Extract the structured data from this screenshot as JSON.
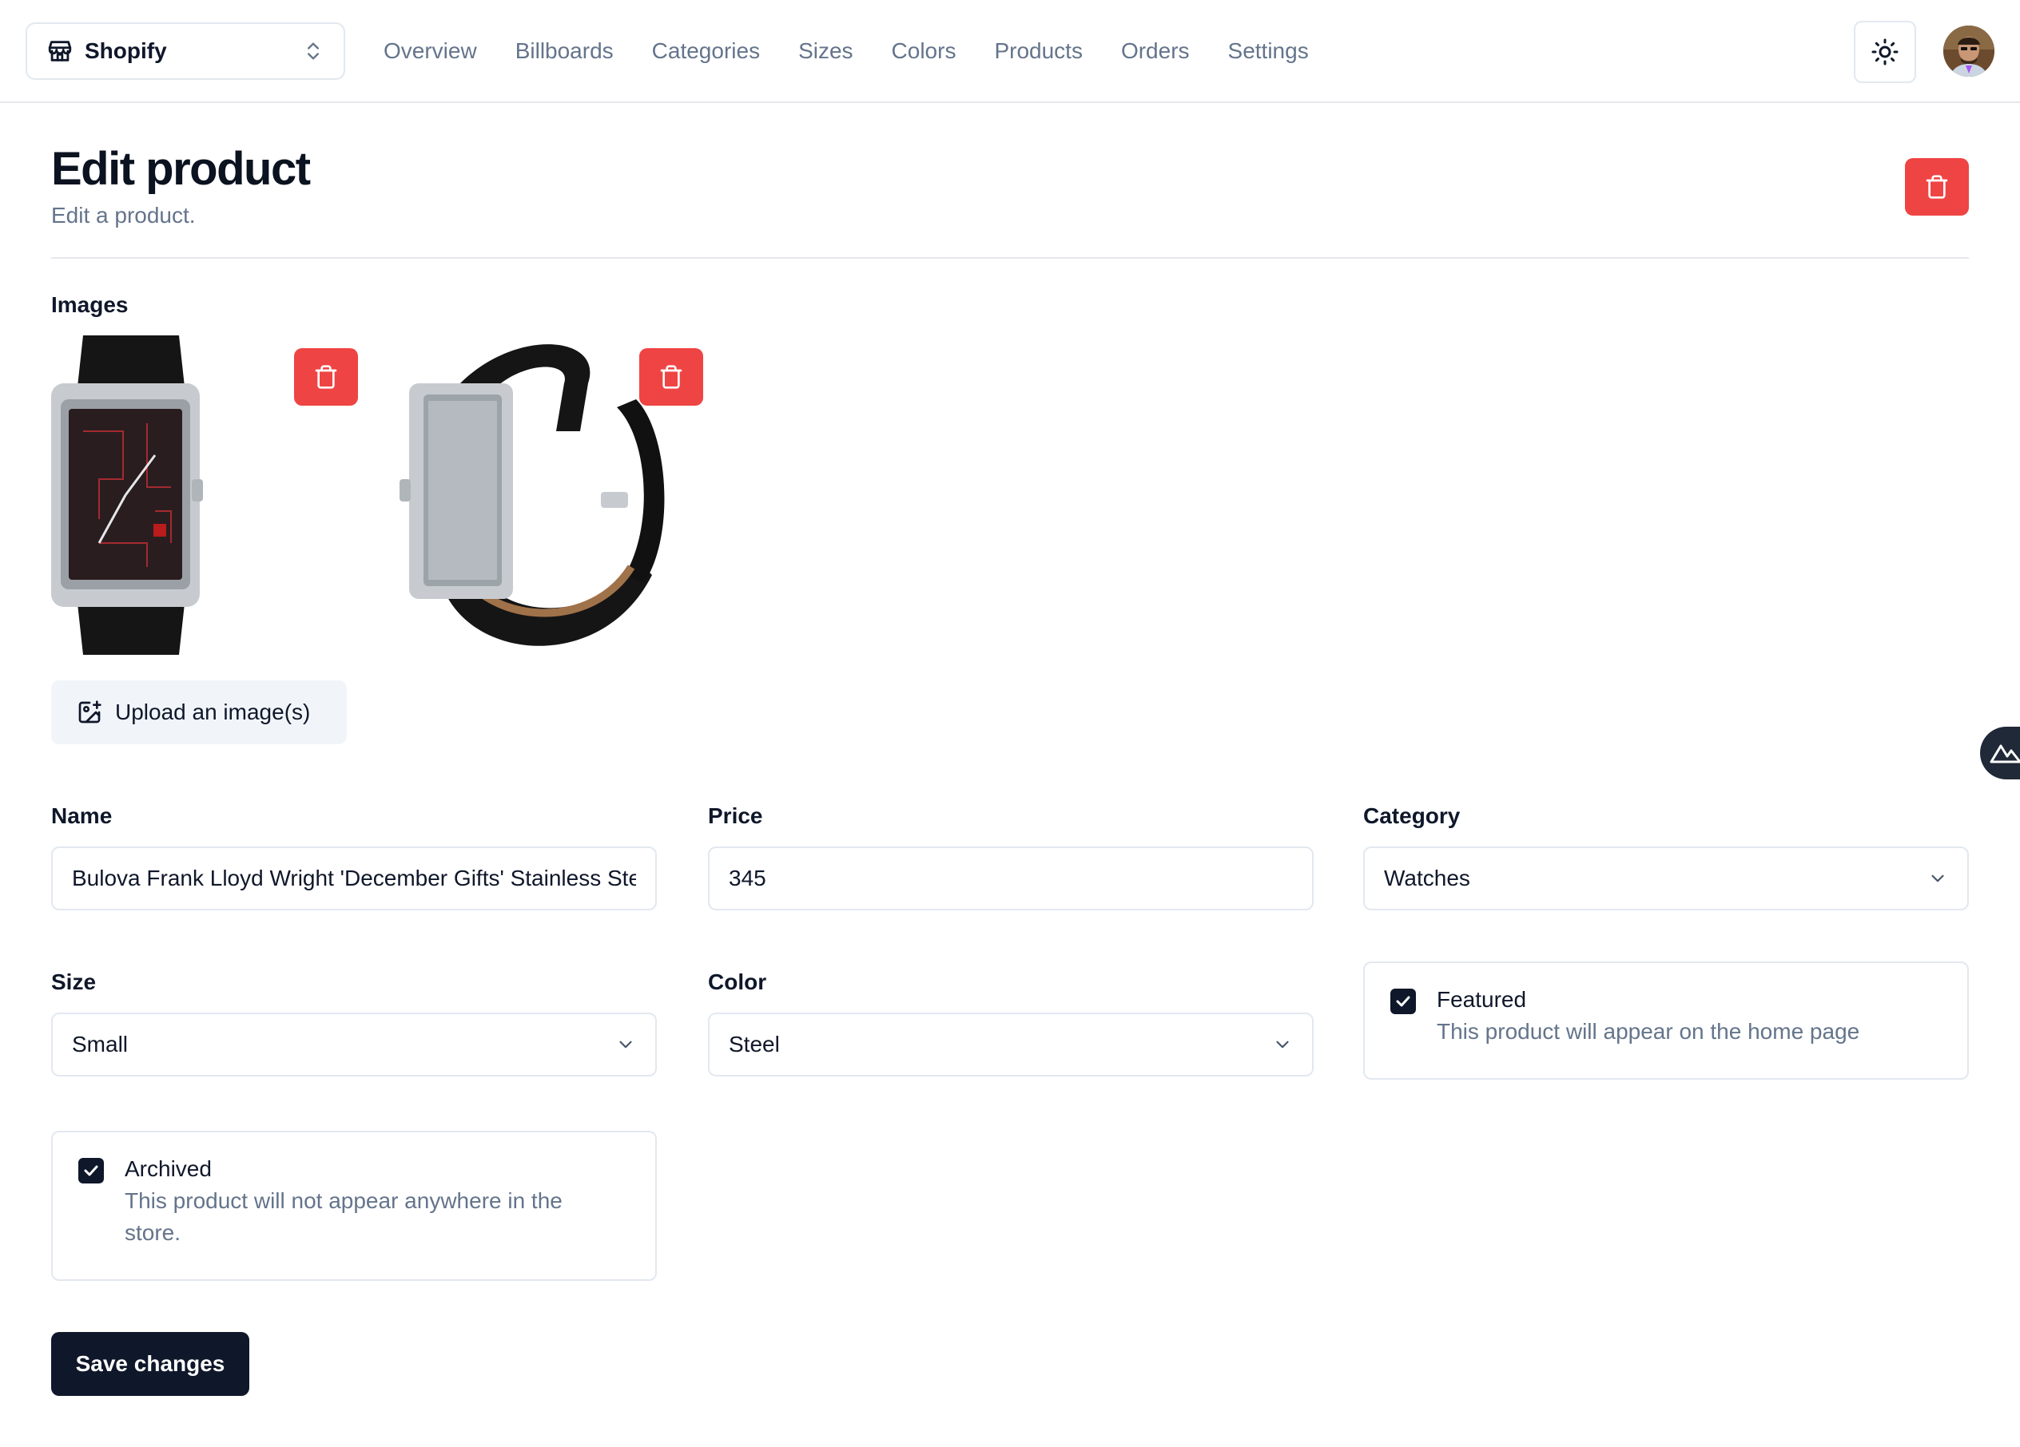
{
  "nav": {
    "store_name": "Shopify",
    "links": [
      "Overview",
      "Billboards",
      "Categories",
      "Sizes",
      "Colors",
      "Products",
      "Orders",
      "Settings"
    ]
  },
  "header": {
    "title": "Edit product",
    "subtitle": "Edit a product."
  },
  "images": {
    "label": "Images",
    "upload_label": "Upload an image(s)"
  },
  "form": {
    "name": {
      "label": "Name",
      "value": "Bulova Frank Lloyd Wright 'December Gifts' Stainless Steel"
    },
    "price": {
      "label": "Price",
      "value": "345"
    },
    "category": {
      "label": "Category",
      "value": "Watches"
    },
    "size": {
      "label": "Size",
      "value": "Small"
    },
    "color": {
      "label": "Color",
      "value": "Steel"
    },
    "featured": {
      "title": "Featured",
      "description": "This product will appear on the home page",
      "checked": true
    },
    "archived": {
      "title": "Archived",
      "description_line1": "This product will not appear anywhere in the",
      "description_line2": "store.",
      "checked": true
    },
    "save_label": "Save changes"
  },
  "colors": {
    "primary": "#0f172a",
    "danger": "#ef4444",
    "muted": "#64748b",
    "border": "#e2e8f0"
  }
}
